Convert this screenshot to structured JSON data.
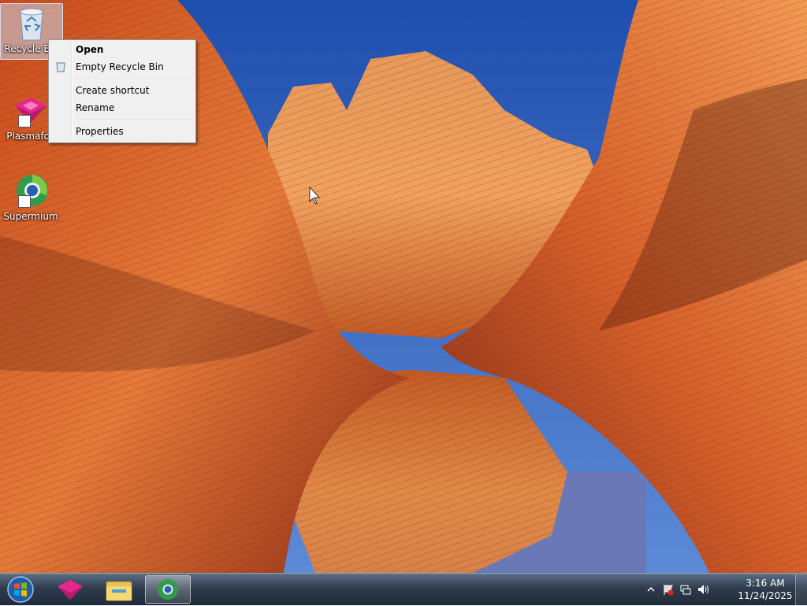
{
  "desktop": {
    "icons": [
      {
        "label": "Recycle Bin",
        "icon": "recycle-bin-icon"
      },
      {
        "label": "Plasmafox",
        "icon": "plasmafox-icon"
      },
      {
        "label": "Supermium",
        "icon": "supermium-icon"
      }
    ]
  },
  "context_menu": {
    "items": [
      {
        "label": "Open",
        "bold": true
      },
      {
        "label": "Empty Recycle Bin",
        "icon": "recycle-bin-small-icon"
      },
      {
        "label": "Create shortcut"
      },
      {
        "label": "Rename"
      },
      {
        "label": "Properties"
      }
    ]
  },
  "taskbar": {
    "pinned": [
      {
        "name": "Plasmafox",
        "icon": "plasmafox-icon"
      },
      {
        "name": "Windows Explorer",
        "icon": "folder-icon"
      },
      {
        "name": "Supermium",
        "icon": "supermium-icon",
        "active": true
      }
    ],
    "tray": {
      "icons": [
        "show-hidden-icons-chevron",
        "action-center-flag-icon",
        "network-icon",
        "volume-icon"
      ]
    },
    "clock": {
      "time": "3:16 AM",
      "date": "11/24/2025"
    }
  },
  "colors": {
    "sky": "#2a5bb8",
    "rock_orange": "#e0682a",
    "rock_red": "#a83418",
    "taskbar": "#2f3c4d"
  }
}
